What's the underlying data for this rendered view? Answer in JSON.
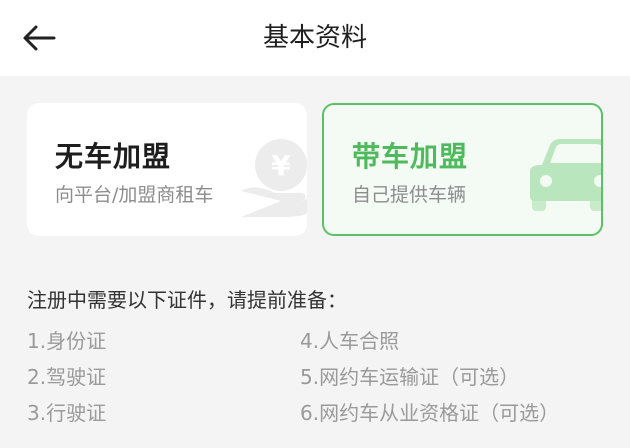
{
  "header": {
    "title": "基本资料"
  },
  "cards": [
    {
      "title": "无车加盟",
      "subtitle": "向平台/加盟商租车",
      "icon": "yen-hand-icon",
      "selected": false
    },
    {
      "title": "带车加盟",
      "subtitle": "自己提供车辆",
      "icon": "car-icon",
      "selected": true
    }
  ],
  "requirements": {
    "title": "注册中需要以下证件，请提前准备：",
    "items": [
      "1.身份证",
      "2.驾驶证",
      "3.行驶证",
      "4.人车合照",
      "5.网约车运输证（可选）",
      "6.网约车从业资格证（可选）"
    ]
  },
  "colors": {
    "accent": "#4fba5b",
    "accent_border": "#5ac265",
    "selected_card_bg": "#f3fbf4",
    "page_bg": "#f4f4f4"
  }
}
